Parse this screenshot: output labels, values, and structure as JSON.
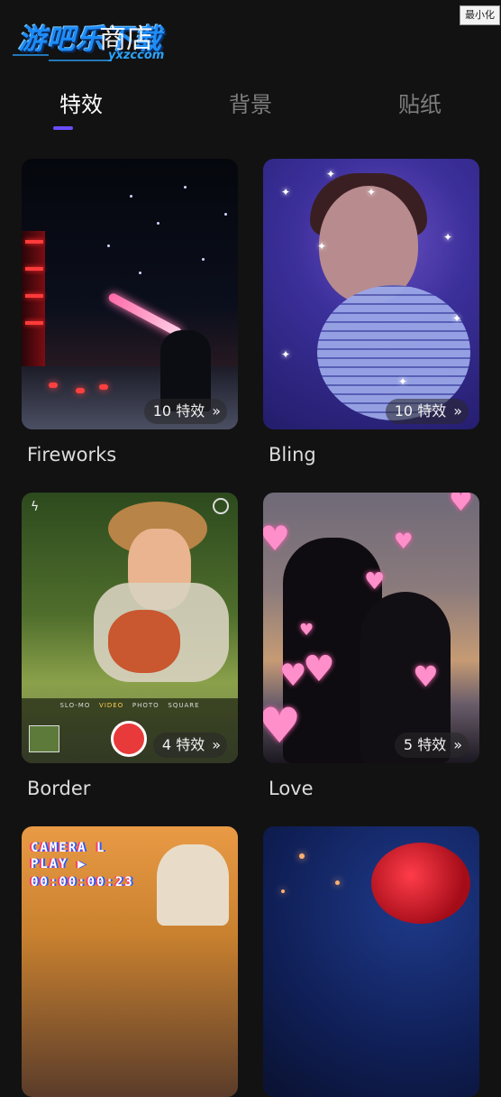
{
  "header": {
    "logo_text": "游吧乐下载",
    "logo_domain": "yxzccom",
    "store_title": "商店",
    "minimize_label": "最小化"
  },
  "tabs": [
    {
      "label": "特效",
      "active": true
    },
    {
      "label": "背景",
      "active": false
    },
    {
      "label": "贴纸",
      "active": false
    }
  ],
  "accent_color": "#6c4dff",
  "items": [
    {
      "title": "Fireworks",
      "count": "10 特效"
    },
    {
      "title": "Bling",
      "count": "10 特效"
    },
    {
      "title": "Border",
      "count": "4 特效"
    },
    {
      "title": "Love",
      "count": "5 特效"
    },
    {
      "title": "",
      "count": ""
    },
    {
      "title": "",
      "count": ""
    }
  ],
  "border_preview": {
    "camera_modes": [
      "SLO-MO",
      "VIDEO",
      "PHOTO",
      "SQUARE"
    ]
  },
  "retro_preview": {
    "lines": [
      "CAMERA L",
      "PLAY ▶",
      "00:00:00:23"
    ]
  },
  "icons": {
    "chevron": "double-chevron-right-icon",
    "flash": "flash-icon",
    "lens": "camera-lens-icon"
  }
}
